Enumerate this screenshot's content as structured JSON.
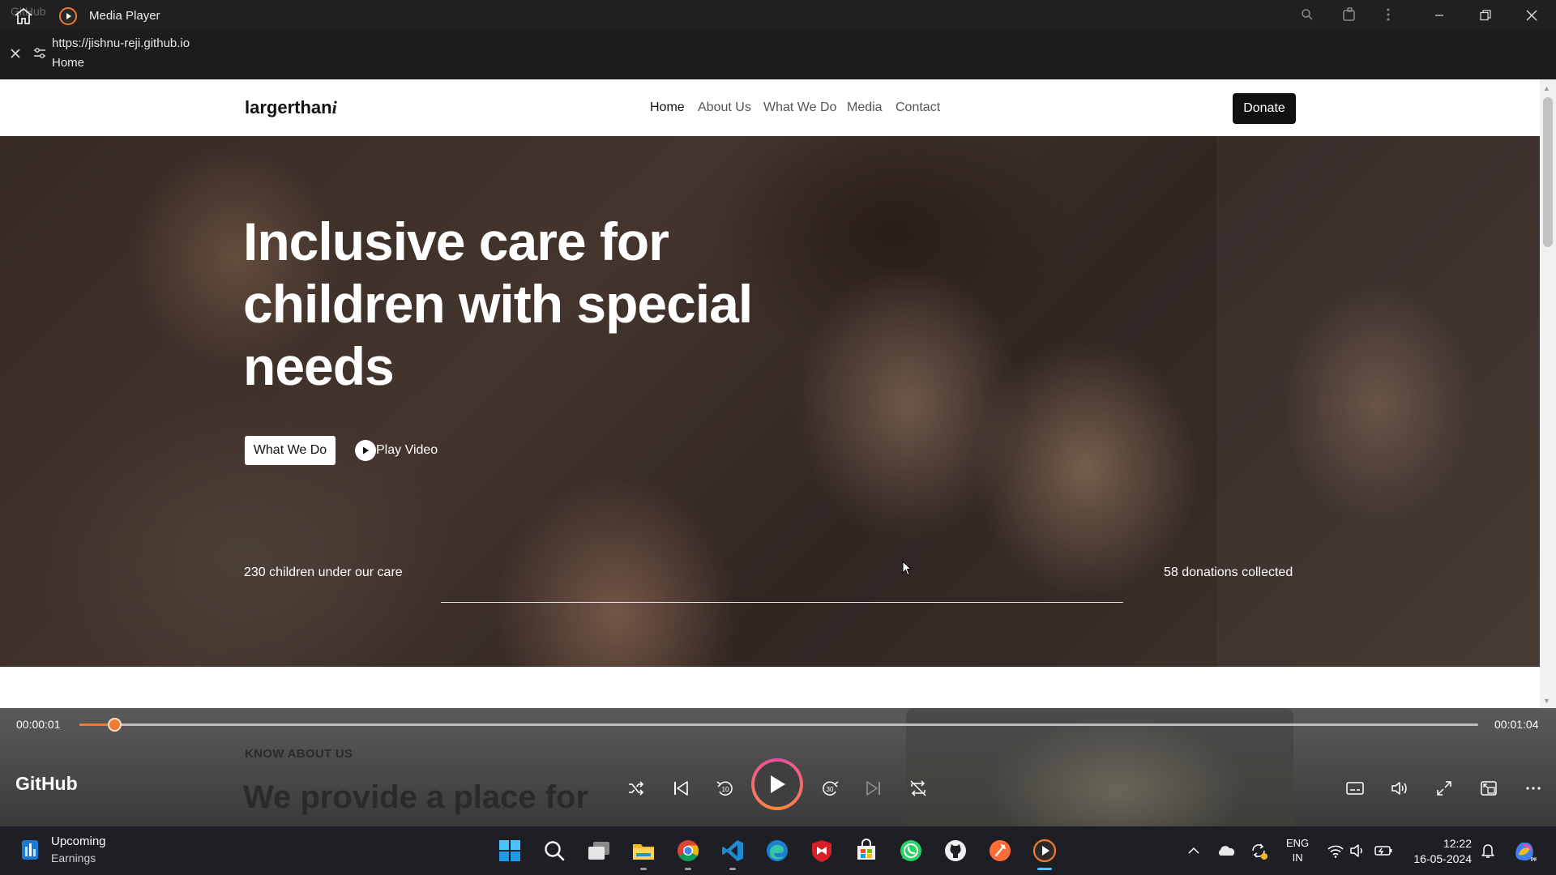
{
  "titlebar": {
    "ghost_text": "GitHub",
    "title": "Media Player"
  },
  "urlbar": {
    "url": "https://jishnu-reji.github.io",
    "page_title": "Home"
  },
  "site": {
    "logo_text": "largerthan",
    "logo_suffix": "i",
    "nav": [
      "Home",
      "About Us",
      "What We Do",
      "Media",
      "Contact"
    ],
    "donate_label": "Donate",
    "hero": {
      "headline": "Inclusive care for children with special needs",
      "cta_label": "What We Do",
      "play_label": "Play Video",
      "stat_left": "230 children under our care",
      "stat_right": "58 donations collected"
    },
    "peek": {
      "subheading": "KNOW ABOUT US",
      "heading": "We provide a place for"
    }
  },
  "player": {
    "elapsed": "00:00:01",
    "duration": "00:01:04",
    "progress_fraction": 0.016,
    "media_title": "GitHub",
    "accent": "#f07a30"
  },
  "taskbar": {
    "widget_title": "Upcoming",
    "widget_sub": "Earnings",
    "lang_1": "ENG",
    "lang_2": "IN",
    "time": "12:22",
    "date": "16-05-2024",
    "apps": [
      "start-icon",
      "search-icon",
      "task-view-icon",
      "file-explorer-icon",
      "chrome-icon",
      "vscode-icon",
      "edge-icon",
      "mcafee-icon",
      "ms-store-icon",
      "whatsapp-icon",
      "github-desktop-icon",
      "postman-icon",
      "media-player-icon"
    ]
  }
}
